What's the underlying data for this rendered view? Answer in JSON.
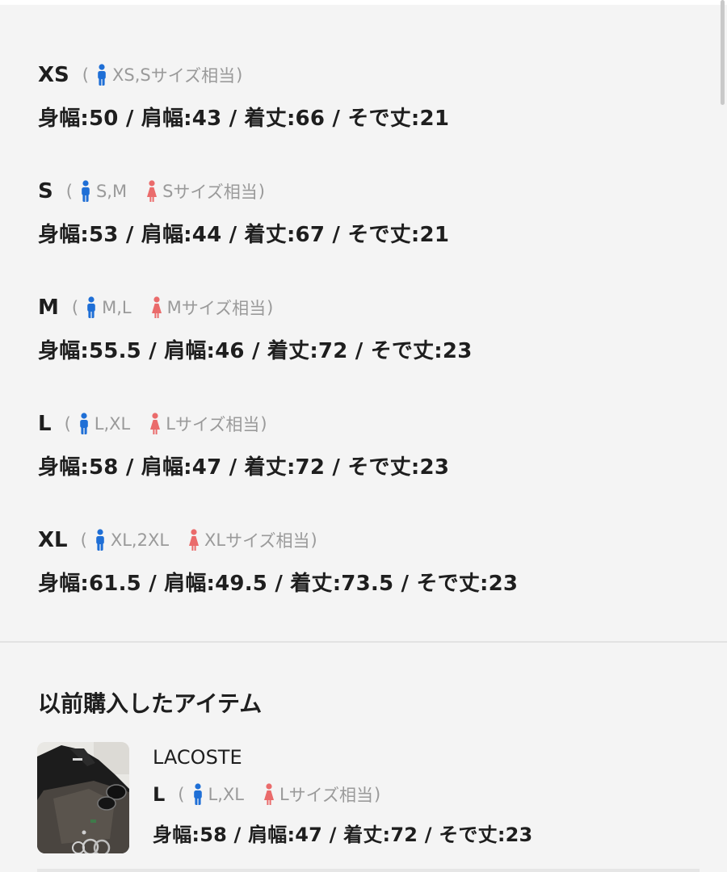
{
  "sizes": [
    {
      "name": "XS",
      "male": "XS,S",
      "female": "",
      "equiv_suffix": "サイズ相当",
      "measure": "身幅:50 / 肩幅:43 / 着丈:66 / そで丈:21"
    },
    {
      "name": "S",
      "male": "S,M",
      "female": "S",
      "equiv_suffix": "サイズ相当",
      "measure": "身幅:53 / 肩幅:44 / 着丈:67 / そで丈:21"
    },
    {
      "name": "M",
      "male": "M,L",
      "female": "M",
      "equiv_suffix": "サイズ相当",
      "measure": "身幅:55.5 / 肩幅:46 / 着丈:72 / そで丈:23"
    },
    {
      "name": "L",
      "male": "L,XL",
      "female": "L",
      "equiv_suffix": "サイズ相当",
      "measure": "身幅:58 / 肩幅:47 / 着丈:72 / そで丈:23"
    },
    {
      "name": "XL",
      "male": "XL,2XL",
      "female": "XL",
      "equiv_suffix": "サイズ相当",
      "measure": "身幅:61.5 / 肩幅:49.5 / 着丈:73.5 / そで丈:23"
    }
  ],
  "paren_open": "(",
  "paren_close": ")",
  "previous": {
    "title": "以前購入したアイテム",
    "item": {
      "brand": "LACOSTE",
      "size": "L",
      "male": "L,XL",
      "female": "L",
      "equiv_suffix": "サイズ相当",
      "measure": "身幅:58 / 肩幅:47 / 着丈:72 / そで丈:23"
    }
  },
  "icons": {
    "male": "male-figure-icon",
    "female": "female-figure-icon"
  },
  "colors": {
    "male_icon": "#1f6fd6",
    "female_icon": "#ea6b6b",
    "secondary_text": "#9a9a9a",
    "primary_text": "#1e1e1e",
    "background": "#f4f4f4"
  }
}
